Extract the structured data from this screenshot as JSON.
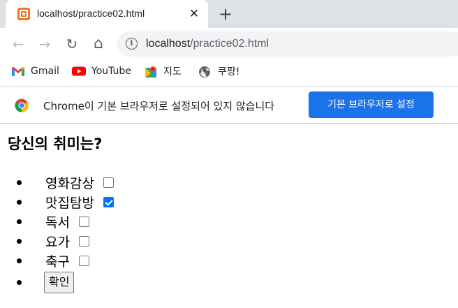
{
  "tab": {
    "title": "localhost/practice02.html",
    "favicon": "xampp-icon",
    "close_glyph": "✕",
    "new_tab_glyph": "+"
  },
  "toolbar": {
    "back_glyph": "←",
    "forward_glyph": "→",
    "reload_glyph": "↻",
    "home_glyph": "⌂",
    "info_glyph": "i",
    "url_host": "localhost",
    "url_path": "/practice02.html"
  },
  "bookmarks": [
    {
      "label": "Gmail",
      "icon": "gmail-icon"
    },
    {
      "label": "YouTube",
      "icon": "youtube-icon"
    },
    {
      "label": "지도",
      "icon": "maps-icon"
    },
    {
      "label": "쿠팡!",
      "icon": "globe-icon"
    }
  ],
  "infobar": {
    "message": "Chrome이 기본 브라우저로 설정되어 있지 않습니다",
    "button_label": "기본 브라우저로 설정",
    "button_color": "#1a73e8"
  },
  "page": {
    "heading": "당신의 취미는?",
    "hobbies": [
      {
        "label": "영화감상",
        "checked": false
      },
      {
        "label": "맛집탐방",
        "checked": true
      },
      {
        "label": "독서",
        "checked": false
      },
      {
        "label": "요가",
        "checked": false
      },
      {
        "label": "축구",
        "checked": false
      }
    ],
    "confirm_label": "확인",
    "checkbox_accent": "#0075ff"
  }
}
